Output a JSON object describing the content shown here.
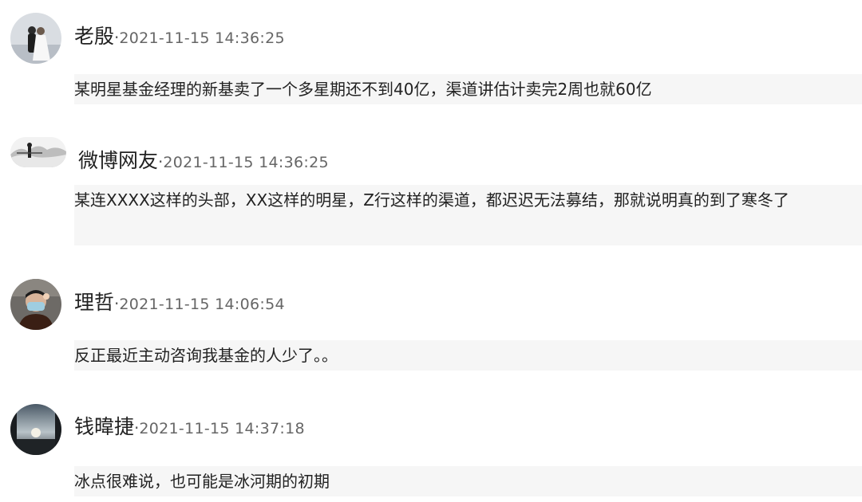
{
  "comments": [
    {
      "name": "老殷",
      "separator": "·",
      "time": "2021-11-15 14:36:25",
      "text": "某明星基金经理的新基卖了一个多星期还不到40亿，渠道讲估计卖完2周也就60亿",
      "avatar": "wedding-photo-avatar"
    },
    {
      "name": "微博网友",
      "separator": "·",
      "time": "2021-11-15 14:36:25",
      "text": "某连XXXX这样的头部，XX这样的明星，Z行这样的渠道，都迟迟无法募结，那就说明真的到了寒冬了",
      "avatar": "ink-landscape-avatar"
    },
    {
      "name": "理哲",
      "separator": "·",
      "time": "2021-11-15 14:06:54",
      "text": "反正最近主动咨询我基金的人少了。。",
      "avatar": "masked-person-avatar"
    },
    {
      "name": "钱暐捷",
      "separator": "·",
      "time": "2021-11-15 14:37:18",
      "text": "冰点很难说，也可能是冰河期的初期",
      "avatar": "sunset-sky-avatar"
    }
  ]
}
